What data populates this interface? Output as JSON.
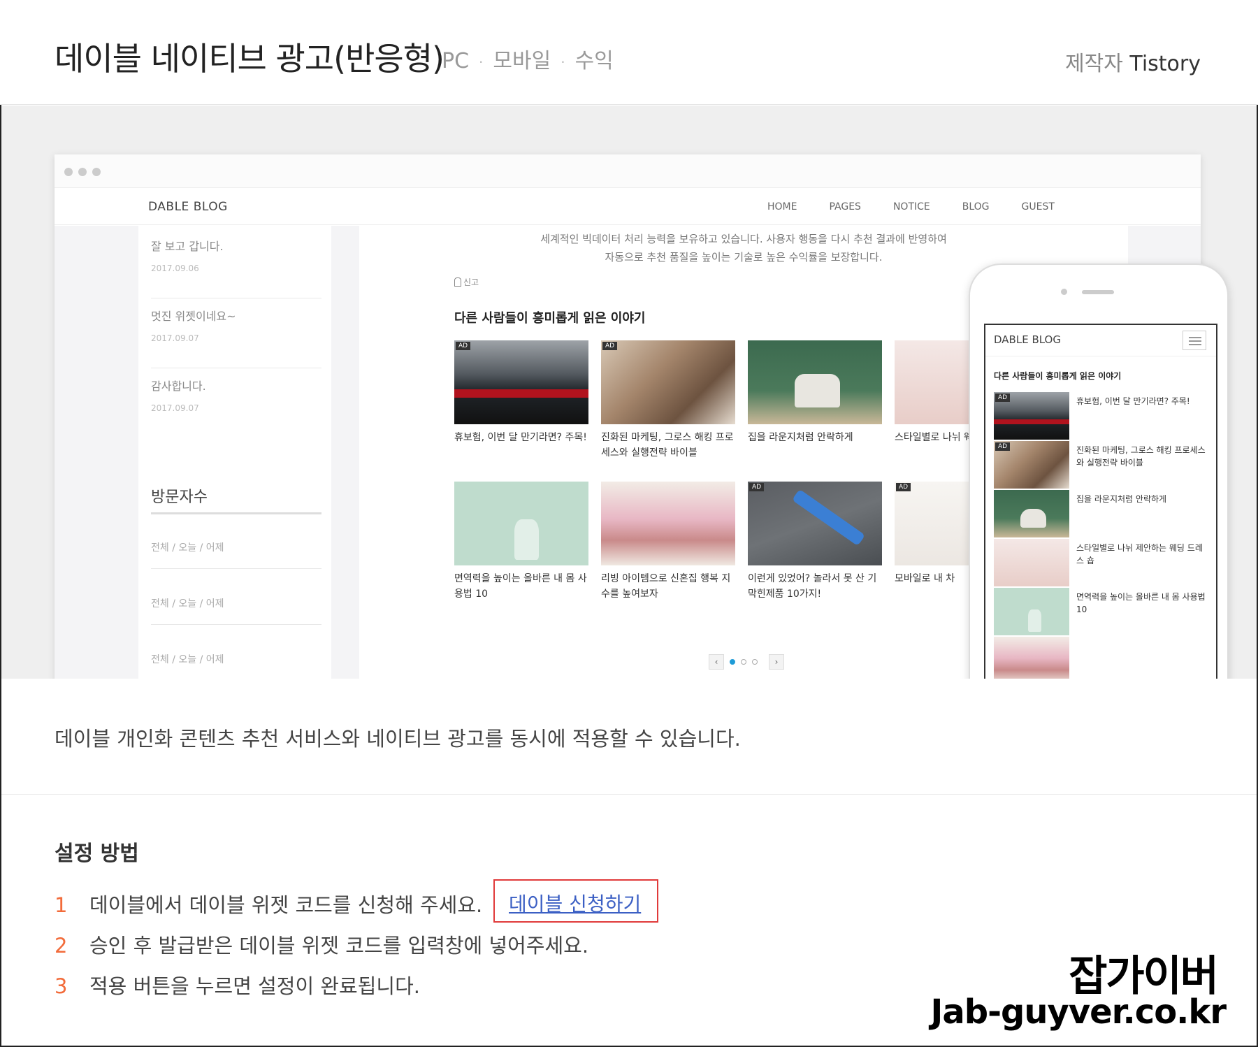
{
  "header": {
    "title": "데이블 네이티브 광고(반응형)",
    "tags": [
      "PC",
      "모바일",
      "수익"
    ],
    "maker_label": "제작자",
    "maker_name": "Tistory"
  },
  "preview": {
    "site_logo": "DABLE BLOG",
    "site_menu": [
      "HOME",
      "PAGES",
      "NOTICE",
      "BLOG",
      "GUEST"
    ],
    "comments": [
      {
        "text": "잘 보고 갑니다.",
        "date": "2017.09.06"
      },
      {
        "text": "멋진 위젯이네요~",
        "date": "2017.09.07"
      },
      {
        "text": "감사합니다.",
        "date": "2017.09.07"
      }
    ],
    "visitor_title": "방문자수",
    "visitor_rows": [
      "전체 / 오늘 / 어제",
      "전체 / 오늘 / 어제",
      "전체 / 오늘 / 어제"
    ],
    "intro_line1": "세계적인 빅데이터 처리 능력을 보유하고 있습니다. 사용자 행동을 다시 추천 결과에 반영하여",
    "intro_line2": "자동으로 추천 품질을 높이는 기술로 높은 수익률을 보장합니다.",
    "report_label": "신고",
    "rec_title": "다른 사람들이 흥미롭게 읽은 이야기",
    "ad_badge": "AD",
    "cards": [
      {
        "caption": "휴보험, 이번 달 만기라면? 주목!",
        "ad": true
      },
      {
        "caption": "진화된 마케팅, 그로스 해킹 프로세스와 실행전략 바이블",
        "ad": true
      },
      {
        "caption": "집을 라운지처럼 안락하게",
        "ad": false
      },
      {
        "caption": "스타일별로 나뉘 웨딩드레스 숍",
        "ad": false
      },
      {
        "caption": "면역력을 높이는 올바른 내 몸 사용법 10",
        "ad": false
      },
      {
        "caption": "리빙 아이템으로 신혼집 행복 지수를 높여보자",
        "ad": false
      },
      {
        "caption": "이런게 있었어? 놀라서 못 산 기막힌제품 10가지!",
        "ad": true
      },
      {
        "caption": "모바일로 내 차",
        "ad": true
      }
    ],
    "pager": {
      "prev": "‹",
      "next": "›"
    },
    "phone": {
      "logo": "DABLE BLOG",
      "rec_title": "다른 사람들이 흥미롭게 읽은 이야기",
      "items": [
        "휴보험, 이번 달 만기라면? 주목!",
        "진화된 마케팅, 그로스 해킹 프로세스와 실행전략 바이블",
        "집을 라운지처럼 안락하게",
        "스타일별로 나뉘 제안하는 웨딩 드레스 숍",
        "면역력을 높이는 올바른 내 몸 사용법 10"
      ]
    }
  },
  "description": "데이블 개인화 콘텐츠 추천 서비스와 네이티브 광고를 동시에 적용할 수 있습니다.",
  "setup": {
    "title": "설정 방법",
    "steps": [
      {
        "num": "1",
        "text": "데이블에서 데이블 위젯 코드를 신청해 주세요."
      },
      {
        "num": "2",
        "text": "승인 후 발급받은 데이블 위젯 코드를 입력창에 넣어주세요."
      },
      {
        "num": "3",
        "text": "적용 버튼을 누르면 설정이 완료됩니다."
      }
    ],
    "apply_link": "데이블 신청하기"
  },
  "watermark": {
    "name": "잡가이버",
    "url": "Jab-guyver.co.kr"
  },
  "colors": {
    "step_number": "#f26b3a",
    "link": "#3b5fc4",
    "highlight_box": "#e03a3a",
    "pager_active": "#1e9bd7"
  }
}
